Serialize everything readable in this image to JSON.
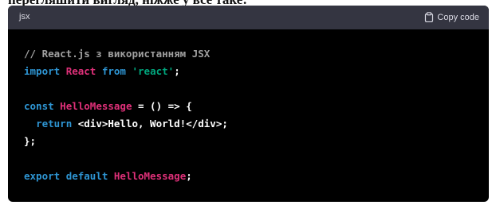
{
  "article": {
    "cut_text": "перегляшити вигляд, ніжже у всё таке:"
  },
  "code_block": {
    "language": "jsx",
    "copy_label": "Copy code",
    "copy_icon": "clipboard-icon",
    "colors": {
      "background": "#000000",
      "header": "#343541",
      "comment": "#a0a0a0",
      "keyword": "#2e95d3",
      "identifier": "#df3079",
      "string": "#00a67d",
      "plain": "#ffffff"
    },
    "lines": [
      [
        {
          "t": "comment",
          "v": "// React.js з використанням JSX"
        }
      ],
      [
        {
          "t": "keyword",
          "v": "import"
        },
        {
          "t": "plain",
          "v": " "
        },
        {
          "t": "ident",
          "v": "React"
        },
        {
          "t": "plain",
          "v": " "
        },
        {
          "t": "keyword",
          "v": "from"
        },
        {
          "t": "plain",
          "v": " "
        },
        {
          "t": "string",
          "v": "'react'"
        },
        {
          "t": "plain",
          "v": ";"
        }
      ],
      [],
      [
        {
          "t": "keyword",
          "v": "const"
        },
        {
          "t": "plain",
          "v": " "
        },
        {
          "t": "ident",
          "v": "HelloMessage"
        },
        {
          "t": "plain",
          "v": " = () => {"
        }
      ],
      [
        {
          "t": "plain",
          "v": "  "
        },
        {
          "t": "keyword",
          "v": "return"
        },
        {
          "t": "plain",
          "v": " <div>Hello, World!</div>;"
        }
      ],
      [
        {
          "t": "plain",
          "v": "};"
        }
      ],
      [],
      [
        {
          "t": "keyword",
          "v": "export"
        },
        {
          "t": "plain",
          "v": " "
        },
        {
          "t": "keyword",
          "v": "default"
        },
        {
          "t": "plain",
          "v": " "
        },
        {
          "t": "ident",
          "v": "HelloMessage"
        },
        {
          "t": "plain",
          "v": ";"
        }
      ]
    ]
  }
}
